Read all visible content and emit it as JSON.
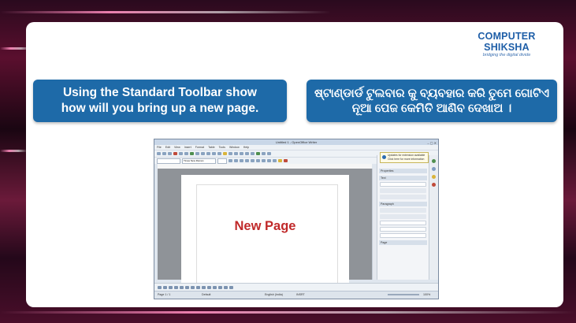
{
  "logo": {
    "name": "COMPUTER SHIKSHA",
    "tagline": "bridging the digital divide"
  },
  "banner_left": {
    "line1": "Using the Standard Toolbar show",
    "line2": "how will you bring up a new page."
  },
  "banner_right": {
    "line1": "ଷ୍ଟାଣ୍ଡାର୍ଡ ଟୁଲବାର କୁ ବ୍ୟବହାର କରି ତୁମେ ଗୋଟିଏ",
    "line2": "ନୂଆ ପେଜ କେମିତି ଆଣିବ ଦେଖାଅ ।"
  },
  "window": {
    "title": "Untitled 1 - OpenOffice Writer",
    "menu": [
      "File",
      "Edit",
      "View",
      "Insert",
      "Format",
      "Table",
      "Tools",
      "Window",
      "Help"
    ],
    "font_name": "Times New Roman",
    "page_text": "New Page",
    "notification": {
      "title": "Updates for extension available",
      "body": "Click here for more information"
    },
    "sidebar": {
      "properties": "Properties",
      "text": "Text",
      "paragraph": "Paragraph",
      "page": "Page"
    },
    "status": {
      "page": "Page 1 / 1",
      "style": "Default",
      "language": "English (India)",
      "mode": "INSRT",
      "zoom": "100%"
    }
  }
}
